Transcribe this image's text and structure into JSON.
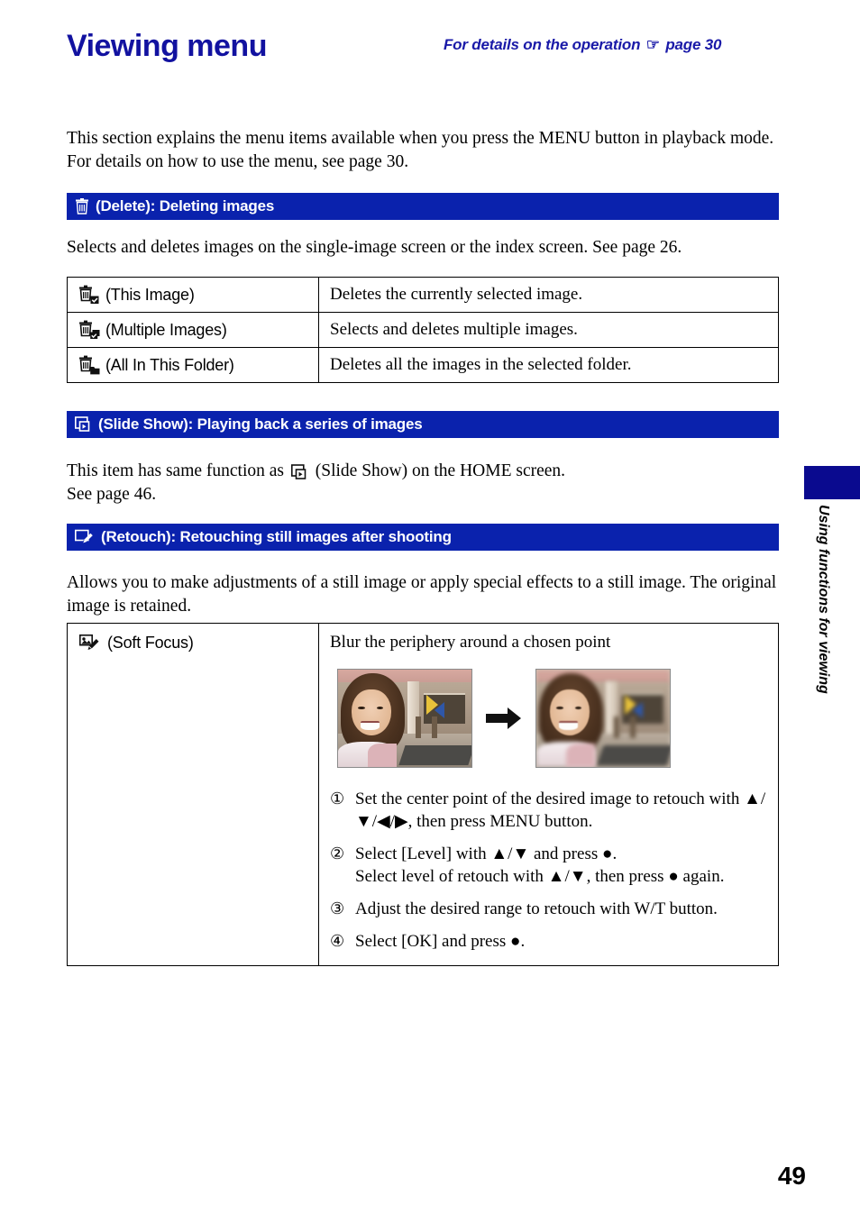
{
  "document": {
    "title": "Viewing menu",
    "header_note_prefix": "For details on the operation",
    "header_note_hand_icon": "pointing-hand-icon",
    "header_note_suffix": "page 30",
    "page_number": "49",
    "side_tab_label": "Using functions for viewing",
    "accent_blue": "#0a22ad",
    "title_blue": "#1212a0",
    "side_tab_blue": "#0a0a8f"
  },
  "intro": {
    "paragraph": "This section explains the menu items available when you press the MENU button in playback mode. For details on how to use the menu, see page 30."
  },
  "sections": {
    "delete": {
      "icon": "trash-icon",
      "bar_label": "(Delete): Deleting images",
      "paragraph": "Selects and deletes images on the single-image screen or the index screen. See page 26.",
      "rows": [
        {
          "icon": "trash-check-icon",
          "name": "(This Image)",
          "description": "Deletes the currently selected image."
        },
        {
          "icon": "trash-multi-icon",
          "name": "(Multiple Images)",
          "description": "Selects and deletes multiple images."
        },
        {
          "icon": "trash-folder-icon",
          "name": "(All In This Folder)",
          "description": "Deletes all the images in the selected folder."
        }
      ]
    },
    "slideshow": {
      "icon": "slide-show-icon",
      "bar_label": "(Slide Show): Playing back a series of images",
      "paragraph_part1": "This item has same function as",
      "paragraph_part2": "(Slide Show) on the HOME screen.",
      "paragraph_line2": "See page 46."
    },
    "retouch": {
      "icon": "retouch-icon",
      "bar_label": "(Retouch): Retouching still images after shooting",
      "paragraph": "Allows you to make adjustments of a still image or apply special effects to a still image. The original image is retained.",
      "row": {
        "icon": "soft-focus-icon",
        "name": "(Soft Focus)",
        "description": "Blur the periphery around a chosen point",
        "sample_before_alt": "portrait photo before soft focus",
        "sample_arrow": "right-arrow-icon",
        "sample_after_alt": "portrait photo after soft focus",
        "steps": [
          {
            "number": "①",
            "text": "Set the center point of the desired image to retouch with ▲/▼/◀/▶, then press MENU button."
          },
          {
            "number": "②",
            "text": "Select [Level] with ▲/▼ and press ●.\nSelect level of retouch with ▲/▼, then press ● again."
          },
          {
            "number": "③",
            "text": "Adjust the desired range to retouch with W/T button."
          },
          {
            "number": "④",
            "text": "Select [OK] and press ●."
          }
        ]
      }
    }
  }
}
